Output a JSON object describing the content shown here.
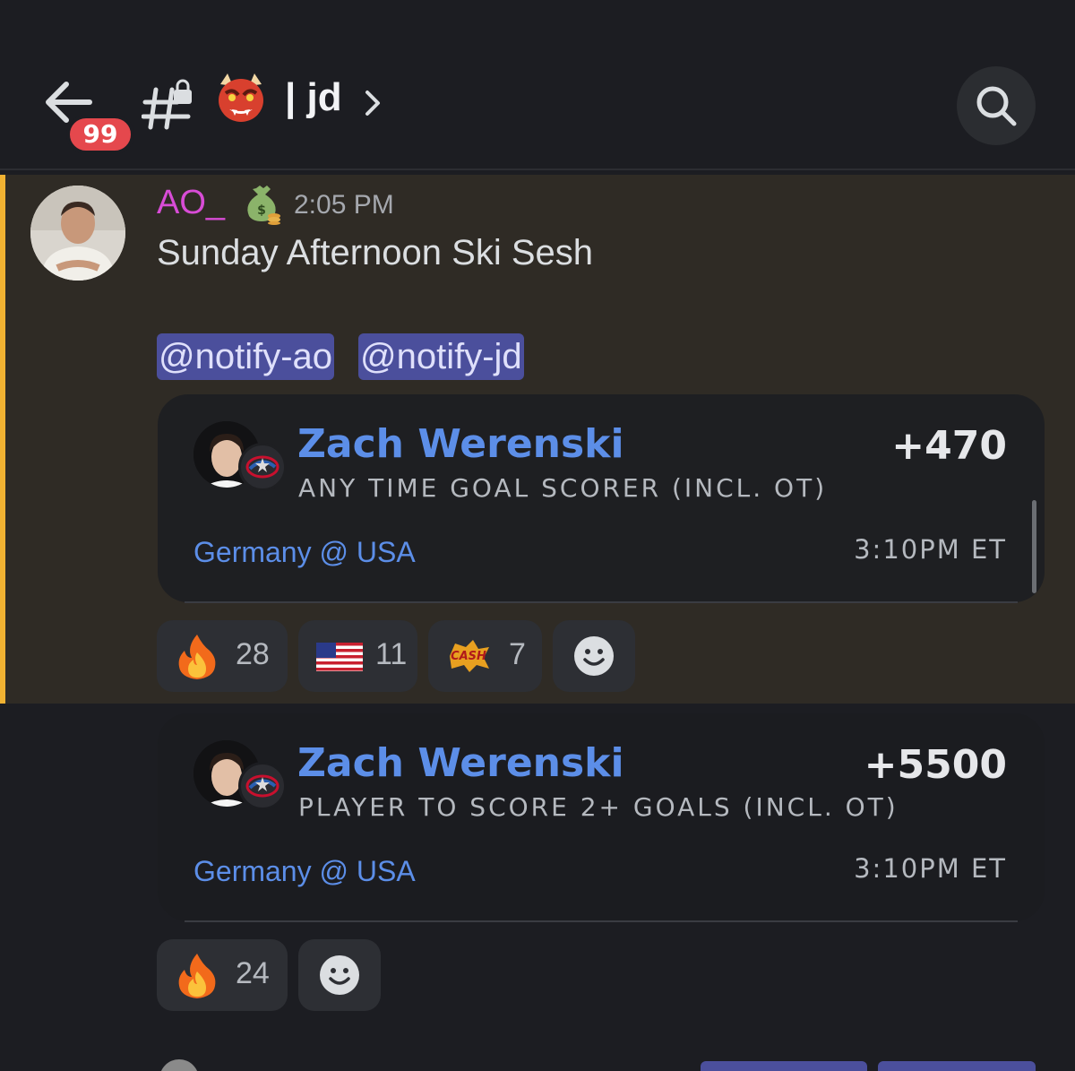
{
  "header": {
    "unread_badge": "99",
    "channel_emoji": "devil-mask-emoji",
    "channel_name": "| jd",
    "icons": [
      "back-arrow-icon",
      "locked-channel-hash-icon",
      "chevron-right-icon",
      "search-icon"
    ]
  },
  "message": {
    "username": "AO_",
    "role_icon": "money-bag-icon",
    "timestamp": "2:05 PM",
    "text": "Sunday Afternoon Ski Sesh",
    "mentions": [
      "@notify-ao",
      "@notify-jd"
    ]
  },
  "cards": [
    {
      "player": "Zach Werenski",
      "market": "ANY TIME GOAL SCORER (INCL. OT)",
      "odds": "+470",
      "matchup": "Germany @ USA",
      "time": "3:10PM ET"
    },
    {
      "player": "Zach Werenski",
      "market": "PLAYER TO SCORE 2+ GOALS (INCL. OT)",
      "odds": "+5500",
      "matchup": "Germany @ USA",
      "time": "3:10PM ET"
    }
  ],
  "reactions1": [
    {
      "emoji": "fire-icon",
      "count": "28"
    },
    {
      "emoji": "us-flag-icon",
      "count": "11"
    },
    {
      "emoji": "cash-it-icon",
      "count": "7"
    },
    {
      "emoji": "add-reaction-icon"
    }
  ],
  "reactions2": [
    {
      "emoji": "fire-icon",
      "count": "24"
    },
    {
      "emoji": "add-reaction-icon"
    }
  ],
  "colors": {
    "accent_bar": "#f0b232",
    "username": "#d84cd6",
    "link_blue": "#5c8ee8",
    "mention_bg": "#4b4f9c",
    "badge_red": "#e5484d"
  }
}
